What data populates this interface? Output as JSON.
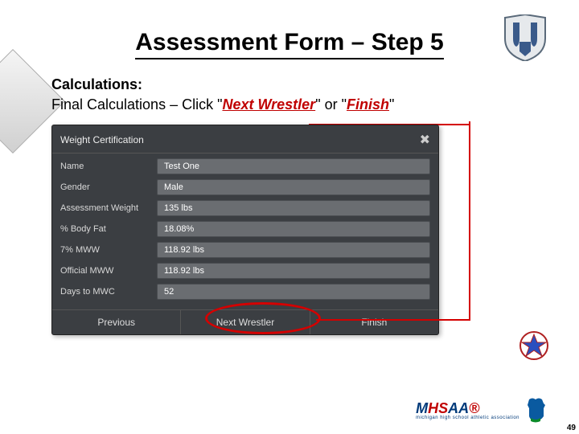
{
  "title": "Assessment Form – Step 5",
  "body": {
    "subhead": "Calculations:",
    "lead_pre": "Final Calculations – Click \"",
    "em1": "Next Wrestler",
    "lead_mid": "\" or \"",
    "em2": "Finish",
    "lead_post": "\""
  },
  "panel": {
    "header": "Weight Certification",
    "close": "✖",
    "rows": [
      {
        "label": "Name",
        "value": "Test One"
      },
      {
        "label": "Gender",
        "value": "Male"
      },
      {
        "label": "Assessment Weight",
        "value": "135 lbs"
      },
      {
        "label": "% Body Fat",
        "value": "18.08%"
      },
      {
        "label": "7% MWW",
        "value": "118.92 lbs"
      },
      {
        "label": "Official MWW",
        "value": "118.92 lbs"
      },
      {
        "label": "Days to MWC",
        "value": "52"
      }
    ],
    "buttons": {
      "prev": "Previous",
      "next": "Next Wrestler",
      "finish": "Finish"
    }
  },
  "footer": {
    "org1": "M",
    "org2": "HS",
    "org3": "AA",
    "org_sub": "michigan high school athletic association",
    "page": "49"
  }
}
